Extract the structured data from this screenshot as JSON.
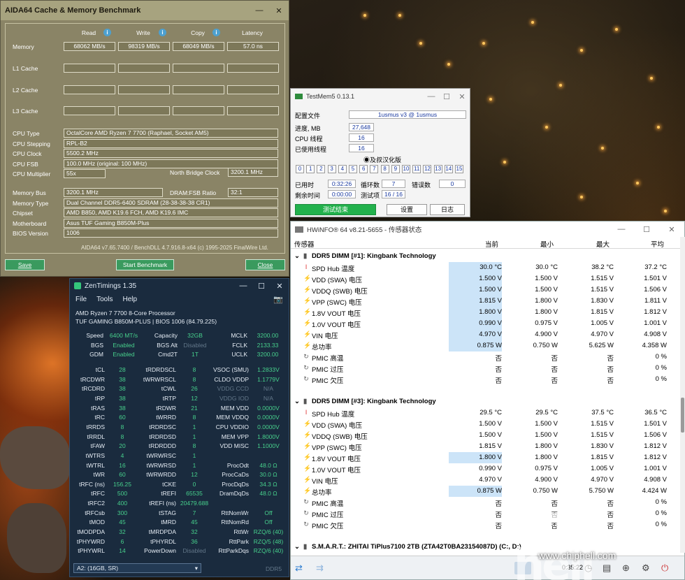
{
  "aida": {
    "title": "AIDA64 Cache & Memory Benchmark",
    "col_read": "Read",
    "col_write": "Write",
    "col_copy": "Copy",
    "col_latency": "Latency",
    "row_memory": "Memory",
    "row_l1": "L1 Cache",
    "row_l2": "L2 Cache",
    "row_l3": "L3 Cache",
    "mem_read": "68062 MB/s",
    "mem_write": "98319 MB/s",
    "mem_copy": "68049 MB/s",
    "mem_latency": "57.0 ns",
    "info": [
      {
        "label": "CPU Type",
        "value": "OctalCore AMD Ryzen 7 7700  (Raphael, Socket AM5)"
      },
      {
        "label": "CPU Stepping",
        "value": "RPL-B2"
      },
      {
        "label": "CPU Clock",
        "value": "5500.2 MHz"
      },
      {
        "label": "CPU FSB",
        "value": "100.0 MHz  (original: 100 MHz)"
      },
      {
        "label": "CPU Multiplier",
        "value": "55x"
      }
    ],
    "nb_label": "North Bridge Clock",
    "nb_value": "3200.1 MHz",
    "info2": [
      {
        "label": "Memory Bus",
        "value": "3200.1 MHz"
      },
      {
        "label": "Memory Type",
        "value": "Dual Channel DDR5-6400 SDRAM  (28-38-38-38 CR1)"
      },
      {
        "label": "Chipset",
        "value": "AMD B850, AMD K19.6 FCH, AMD K19.6 IMC"
      },
      {
        "label": "Motherboard",
        "value": "Asus TUF Gaming B850M-Plus"
      },
      {
        "label": "BIOS Version",
        "value": "1006"
      }
    ],
    "dram_label": "DRAM:FSB Ratio",
    "dram_value": "32:1",
    "footer": "AIDA64 v7.65.7400 / BenchDLL 4.7.916.8-x64  (c) 1995-2025 FinalWire Ltd.",
    "btn_save": "Save",
    "btn_start": "Start Benchmark",
    "btn_close": "Close"
  },
  "testmem": {
    "title": "TestMem5  0.13.1",
    "config_label": "配置文件",
    "config_value": "1usmus v3 @ 1usmus",
    "progress_label": "进度, MB",
    "progress_value": "27,648",
    "threads_label": "CPU 线程",
    "threads_value": "16",
    "used_label": "已使用线程",
    "used_value": "16",
    "radio_label": "◉及叔汉化版",
    "cells": [
      "0",
      "1",
      "2",
      "3",
      "4",
      "5",
      "6",
      "7",
      "8",
      "9",
      "10",
      "11",
      "12",
      "13",
      "14",
      "15"
    ],
    "elapsed_label": "已用时",
    "elapsed_value": "0:32:26",
    "loops_label": "循环数",
    "loops_value": "7",
    "errors_label": "错误数",
    "errors_value": "0",
    "remain_label": "剩余时间",
    "remain_value": "0:00:00",
    "tests_label": "测试项",
    "tests_value": "16 / 16",
    "btn_done": "测试结束",
    "btn_settings": "设置",
    "btn_log": "日志"
  },
  "zen": {
    "title": "ZenTimings 1.35",
    "menu": [
      "File",
      "Tools",
      "Help"
    ],
    "cpu": "AMD Ryzen 7 7700 8-Core Processor",
    "board": "TUF GAMING B850M-PLUS | BIOS 1006 (84.79.225)",
    "top": [
      [
        "Speed",
        "6400 MT/s",
        "Capacity",
        "32GB",
        "MCLK",
        "3200.00"
      ],
      [
        "BGS",
        "Enabled",
        "BGS Alt",
        "Disabled",
        "FCLK",
        "2133.33"
      ],
      [
        "GDM",
        "Enabled",
        "Cmd2T",
        "1T",
        "UCLK",
        "3200.00"
      ]
    ],
    "timings": [
      [
        "tCL",
        "28",
        "tRDRDSCL",
        "8",
        "VSOC (SMU)",
        "1.2833V"
      ],
      [
        "tRCDWR",
        "38",
        "tWRWRSCL",
        "8",
        "CLDO VDDP",
        "1.1779V"
      ],
      [
        "tRCDRD",
        "38",
        "tCWL",
        "26",
        "VDDG CCD",
        "N/A"
      ],
      [
        "tRP",
        "38",
        "tRTP",
        "12",
        "VDDG IOD",
        "N/A"
      ],
      [
        "tRAS",
        "38",
        "tRDWR",
        "21",
        "MEM VDD",
        "0.0000V"
      ],
      [
        "tRC",
        "60",
        "tWRRD",
        "8",
        "MEM VDDQ",
        "0.0000V"
      ],
      [
        "tRRDS",
        "8",
        "tRDRDSC",
        "1",
        "CPU VDDIO",
        "0.0000V"
      ],
      [
        "tRRDL",
        "8",
        "tRDRDSD",
        "1",
        "MEM VPP",
        "1.8000V"
      ],
      [
        "tFAW",
        "20",
        "tRDRDDD",
        "8",
        "VDD MISC",
        "1.1000V"
      ],
      [
        "tWTRS",
        "4",
        "tWRWRSC",
        "1",
        "",
        ""
      ],
      [
        "tWTRL",
        "16",
        "tWRWRSD",
        "1",
        "ProcOdt",
        "48.0 Ω"
      ],
      [
        "tWR",
        "60",
        "tWRWRDD",
        "12",
        "ProcCaDs",
        "30.0 Ω"
      ],
      [
        "tRFC (ns)",
        "156.25",
        "tCKE",
        "0",
        "ProcDqDs",
        "34.3 Ω"
      ],
      [
        "tRFC",
        "500",
        "tREFI",
        "65535",
        "DramDqDs",
        "48.0 Ω"
      ],
      [
        "tRFC2",
        "400",
        "tREFI (ns)",
        "20479.688",
        "",
        ""
      ],
      [
        "tRFCsb",
        "300",
        "tSTAG",
        "7",
        "RttNomWr",
        "Off"
      ],
      [
        "tMOD",
        "45",
        "tMRD",
        "45",
        "RttNomRd",
        "Off"
      ],
      [
        "tMODPDA",
        "32",
        "tMRDPDA",
        "32",
        "RttWr",
        "RZQ/6 (40)"
      ],
      [
        "tPHYWRD",
        "6",
        "tPHYRDL",
        "36",
        "RttPark",
        "RZQ/5 (48)"
      ],
      [
        "tPHYWRL",
        "14",
        "PowerDown",
        "Disabled",
        "RttParkDqs",
        "RZQ/6 (40)"
      ]
    ],
    "select": "A2: (16GB, SR)",
    "footer": "DDR5"
  },
  "hwinfo": {
    "title": "HWiNFO® 64 v8.21-5655 - 传感器状态",
    "col_sensor": "传感器",
    "col_cur": "当前",
    "col_min": "最小",
    "col_max": "最大",
    "col_avg": "平均",
    "group1": "DDR5 DIMM [#1]: Kingbank Technology",
    "rows1": [
      {
        "icon": "therm",
        "name": "SPD Hub 温度",
        "cur": "30.0 °C",
        "min": "30.0 °C",
        "max": "38.2 °C",
        "avg": "37.2 °C",
        "hl": true
      },
      {
        "icon": "bolt",
        "name": "VDD (SWA) 电压",
        "cur": "1.500 V",
        "min": "1.500 V",
        "max": "1.515 V",
        "avg": "1.501 V",
        "hl": true
      },
      {
        "icon": "bolt",
        "name": "VDDQ (SWB) 电压",
        "cur": "1.500 V",
        "min": "1.500 V",
        "max": "1.515 V",
        "avg": "1.506 V",
        "hl": true
      },
      {
        "icon": "bolt",
        "name": "VPP (SWC) 电压",
        "cur": "1.815 V",
        "min": "1.800 V",
        "max": "1.830 V",
        "avg": "1.811 V",
        "hl": true
      },
      {
        "icon": "bolt",
        "name": "1.8V VOUT 电压",
        "cur": "1.800 V",
        "min": "1.800 V",
        "max": "1.815 V",
        "avg": "1.812 V",
        "hl": true
      },
      {
        "icon": "bolt",
        "name": "1.0V VOUT 电压",
        "cur": "0.990 V",
        "min": "0.975 V",
        "max": "1.005 V",
        "avg": "1.001 V",
        "hl": true
      },
      {
        "icon": "bolt",
        "name": "VIN 电压",
        "cur": "4.970 V",
        "min": "4.900 V",
        "max": "4.970 V",
        "avg": "4.908 V",
        "hl": true
      },
      {
        "icon": "bolt",
        "name": "总功率",
        "cur": "0.875 W",
        "min": "0.750 W",
        "max": "5.625 W",
        "avg": "4.358 W",
        "hl": true
      },
      {
        "icon": "spin",
        "name": "PMIC 高温",
        "cur": "否",
        "min": "否",
        "max": "否",
        "avg": "0 %",
        "hl": false
      },
      {
        "icon": "spin",
        "name": "PMIC 过压",
        "cur": "否",
        "min": "否",
        "max": "否",
        "avg": "0 %",
        "hl": false
      },
      {
        "icon": "spin",
        "name": "PMIC 欠压",
        "cur": "否",
        "min": "否",
        "max": "否",
        "avg": "0 %",
        "hl": false
      }
    ],
    "group2": "DDR5 DIMM [#3]: Kingbank Technology",
    "rows2": [
      {
        "icon": "therm",
        "name": "SPD Hub 温度",
        "cur": "29.5 °C",
        "min": "29.5 °C",
        "max": "37.5 °C",
        "avg": "36.5 °C",
        "hl": false
      },
      {
        "icon": "bolt",
        "name": "VDD (SWA) 电压",
        "cur": "1.500 V",
        "min": "1.500 V",
        "max": "1.515 V",
        "avg": "1.501 V",
        "hl": false
      },
      {
        "icon": "bolt",
        "name": "VDDQ (SWB) 电压",
        "cur": "1.500 V",
        "min": "1.500 V",
        "max": "1.515 V",
        "avg": "1.506 V",
        "hl": false
      },
      {
        "icon": "bolt",
        "name": "VPP (SWC) 电压",
        "cur": "1.815 V",
        "min": "1.800 V",
        "max": "1.830 V",
        "avg": "1.812 V",
        "hl": false
      },
      {
        "icon": "bolt",
        "name": "1.8V VOUT 电压",
        "cur": "1.800 V",
        "min": "1.800 V",
        "max": "1.815 V",
        "avg": "1.812 V",
        "hl": true
      },
      {
        "icon": "bolt",
        "name": "1.0V VOUT 电压",
        "cur": "0.990 V",
        "min": "0.975 V",
        "max": "1.005 V",
        "avg": "1.001 V",
        "hl": false
      },
      {
        "icon": "bolt",
        "name": "VIN 电压",
        "cur": "4.970 V",
        "min": "4.900 V",
        "max": "4.970 V",
        "avg": "4.908 V",
        "hl": false
      },
      {
        "icon": "bolt",
        "name": "总功率",
        "cur": "0.875 W",
        "min": "0.750 W",
        "max": "5.750 W",
        "avg": "4.424 W",
        "hl": true
      },
      {
        "icon": "spin",
        "name": "PMIC 高温",
        "cur": "否",
        "min": "否",
        "max": "否",
        "avg": "0 %",
        "hl": false
      },
      {
        "icon": "spin",
        "name": "PMIC 过压",
        "cur": "否",
        "min": "否",
        "max": "否",
        "avg": "0 %",
        "hl": false
      },
      {
        "icon": "spin",
        "name": "PMIC 欠压",
        "cur": "否",
        "min": "否",
        "max": "否",
        "avg": "0 %",
        "hl": false
      }
    ],
    "group3": "S.M.A.R.T.: ZHITAI TiPlus7100 2TB (ZTA42T0BA23154087D) (C:, D:)",
    "clock": "0:35:22"
  },
  "watermark": {
    "text": "chip hell",
    "url": "www.chiphell.com"
  }
}
